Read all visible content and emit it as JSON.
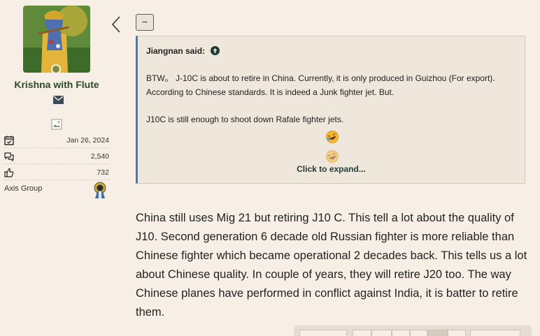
{
  "user": {
    "name": "Krishna with Flute",
    "stats": [
      {
        "icon": "calendar-check-icon",
        "value": "Jan 26, 2024"
      },
      {
        "icon": "messages-icon",
        "value": "2,540"
      },
      {
        "icon": "thumbs-up-icon",
        "value": "732"
      }
    ],
    "group_label": "Axis Group"
  },
  "quote": {
    "author_label": "Jiangnan said:",
    "paragraph1": "BTW。 J-10C is about to retire in China. Currently, it is only produced in Guizhou (For export). According to Chinese standards. It is indeed a Junk fighter jet. But.",
    "paragraph2": "J10C is still enough to shoot down Rafale fighter jets.",
    "expand_label": "Click to expand..."
  },
  "collapse_button_label": "−",
  "post": {
    "text": "China still uses Mig 21 but retiring J10 C. This tell a lot about the quality of J10. Second generation 6 decade old Russian fighter is more reliable than Chinese fighter which became operational 2 decades back. This tells us a lot about Chinese quality. In couple of years, they will retire J20 too. The way Chinese planes have performed in conflict against India, it is batter to retire them."
  },
  "colors": {
    "page_bg": "#f7efe6",
    "username": "#2e4a2a",
    "quote_border_accent": "#5b7a90",
    "link": "#1e3a33"
  }
}
